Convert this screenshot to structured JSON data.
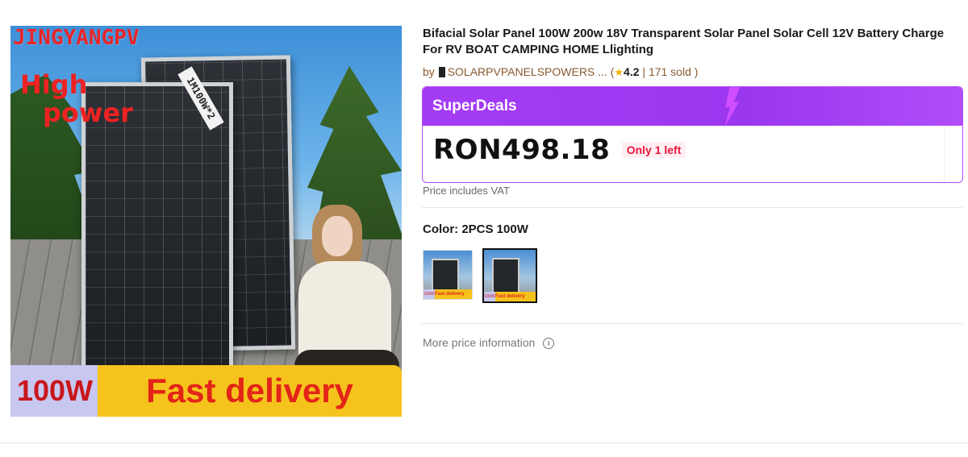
{
  "product_image": {
    "brand_text": "JINGYANGPV",
    "headline_line1": "High",
    "headline_line2": "power",
    "panel_tag": "1M100W*2",
    "watt_badge": "100W",
    "delivery_badge": "Fast delivery"
  },
  "product": {
    "title": "Bifacial Solar Panel 100W 200w 18V Transparent Solar Panel Solar Cell 12V Battery Charge For RV BOAT CAMPING HOME Llighting",
    "by_label": "by",
    "store_name": "SOLARPVPANELSPOWERS ...",
    "rating": "4.2",
    "sold": "171 sold",
    "open_paren": "(",
    "close_paren": ")",
    "separator": "|"
  },
  "deal": {
    "label": "SuperDeals",
    "price": "RON498.18",
    "stock_notice": "Only 1 left",
    "accent_color": "#a53cf5"
  },
  "vat_note": "Price includes VAT",
  "color": {
    "label": "Color: 2PCS 100W",
    "swatches": [
      {
        "watt": "100W",
        "text": "Fast delivery",
        "selected": false
      },
      {
        "watt": "100W",
        "text": "Fast delivery",
        "selected": true
      }
    ]
  },
  "more_price_info": "More price information",
  "icons": {
    "star": "star-icon",
    "info": "info-icon",
    "store": "store-icon"
  }
}
